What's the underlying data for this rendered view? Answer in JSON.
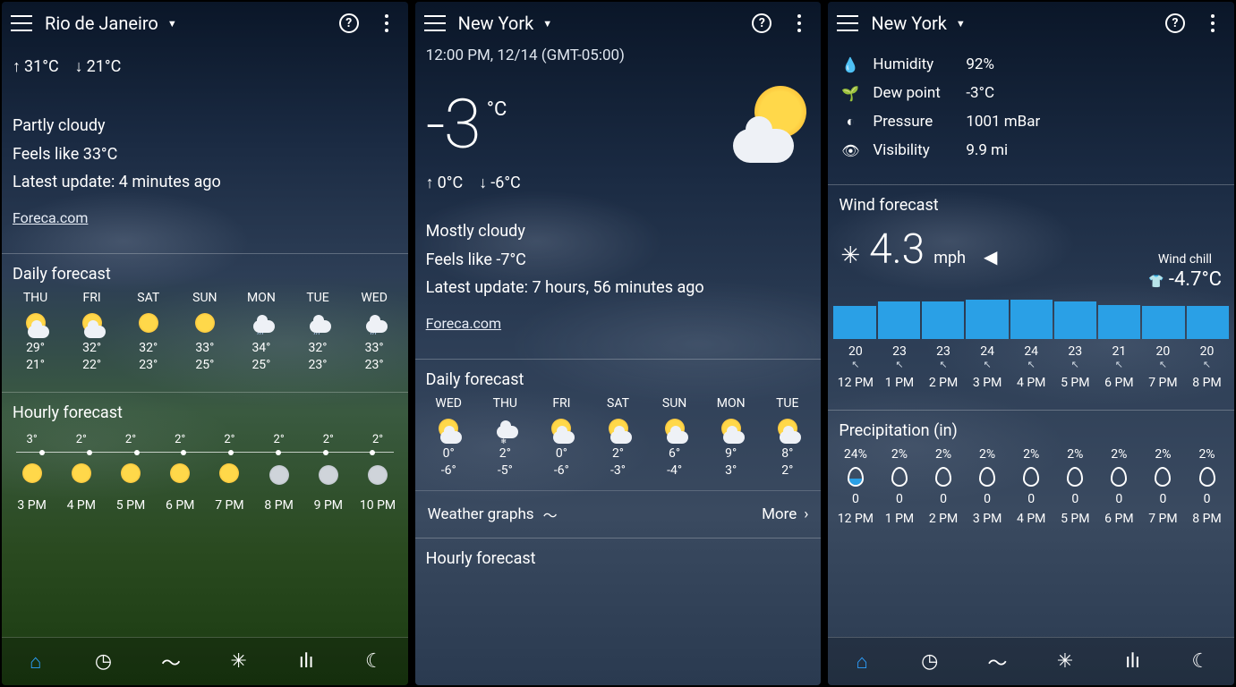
{
  "screens": [
    {
      "city": "Rio de Janeiro",
      "high": "31°C",
      "low": "21°C",
      "condition": "Partly cloudy",
      "feels_like": "Feels like 33°C",
      "update": "Latest update: 4 minutes ago",
      "source_link": "Foreca.com",
      "daily_title": "Daily forecast",
      "daily": [
        {
          "dow": "THU",
          "icon": "partly",
          "hi": "29°",
          "lo": "21°"
        },
        {
          "dow": "FRI",
          "icon": "partly",
          "hi": "32°",
          "lo": "22°"
        },
        {
          "dow": "SAT",
          "icon": "sunny",
          "hi": "32°",
          "lo": "23°"
        },
        {
          "dow": "SUN",
          "icon": "sunny",
          "hi": "33°",
          "lo": "25°"
        },
        {
          "dow": "MON",
          "icon": "rain",
          "hi": "34°",
          "lo": "25°"
        },
        {
          "dow": "TUE",
          "icon": "rain",
          "hi": "32°",
          "lo": "23°"
        },
        {
          "dow": "WED",
          "icon": "rain",
          "hi": "33°",
          "lo": "23°"
        }
      ],
      "hourly_title": "Hourly forecast",
      "hourly_temps": [
        "3°",
        "2°",
        "2°",
        "2°",
        "2°",
        "2°",
        "2°",
        "2°"
      ],
      "hourly": [
        {
          "time": "3 PM",
          "icon": "sunny"
        },
        {
          "time": "4 PM",
          "icon": "sunny"
        },
        {
          "time": "5 PM",
          "icon": "sunny"
        },
        {
          "time": "6 PM",
          "icon": "sunny"
        },
        {
          "time": "7 PM",
          "icon": "sunny"
        },
        {
          "time": "8 PM",
          "icon": "moon"
        },
        {
          "time": "9 PM",
          "icon": "moon"
        },
        {
          "time": "10 PM",
          "icon": "moon"
        }
      ]
    },
    {
      "city": "New York",
      "timestamp": "12:00 PM, 12/14 (GMT-05:00)",
      "temp": "-3",
      "unit": "°C",
      "high": "0°C",
      "low": "-6°C",
      "condition": "Mostly cloudy",
      "feels_like": "Feels like -7°C",
      "update": "Latest update: 7 hours, 56 minutes ago",
      "source_link": "Foreca.com",
      "daily_title": "Daily forecast",
      "daily": [
        {
          "dow": "WED",
          "icon": "partly",
          "hi": "0°",
          "lo": "-6°"
        },
        {
          "dow": "THU",
          "icon": "snow",
          "hi": "2°",
          "lo": "-5°"
        },
        {
          "dow": "FRI",
          "icon": "partly",
          "hi": "0°",
          "lo": "-6°"
        },
        {
          "dow": "SAT",
          "icon": "partly",
          "hi": "2°",
          "lo": "-3°"
        },
        {
          "dow": "SUN",
          "icon": "partly",
          "hi": "6°",
          "lo": "-4°"
        },
        {
          "dow": "MON",
          "icon": "partly",
          "hi": "9°",
          "lo": "3°"
        },
        {
          "dow": "TUE",
          "icon": "partly",
          "hi": "8°",
          "lo": "2°"
        }
      ],
      "graphs_label": "Weather graphs",
      "more_label": "More",
      "hourly_title": "Hourly forecast"
    },
    {
      "city": "New York",
      "details": [
        {
          "icon": "humidity",
          "label": "Humidity",
          "value": "92%"
        },
        {
          "icon": "dew",
          "label": "Dew point",
          "value": "-3°C"
        },
        {
          "icon": "pressure",
          "label": "Pressure",
          "value": "1001 mBar"
        },
        {
          "icon": "visibility",
          "label": "Visibility",
          "value": "9.9 mi"
        }
      ],
      "wind_title": "Wind forecast",
      "wind_speed": "4.3",
      "wind_unit": "mph",
      "wind_chill_label": "Wind chill",
      "wind_chill": "-4.7°C",
      "precip_title": "Precipitation (in)"
    }
  ],
  "nav": {
    "items": [
      "home",
      "clock",
      "graph",
      "wind",
      "bars",
      "moon"
    ]
  },
  "chart_data": [
    {
      "type": "bar",
      "title": "Wind forecast",
      "ylabel": "mph",
      "categories": [
        "12 PM",
        "1 PM",
        "2 PM",
        "3 PM",
        "4 PM",
        "5 PM",
        "6 PM",
        "7 PM",
        "8 PM"
      ],
      "values": [
        20,
        23,
        23,
        24,
        24,
        23,
        21,
        20,
        20
      ]
    },
    {
      "type": "bar",
      "title": "Precipitation (in)",
      "categories": [
        "12 PM",
        "1 PM",
        "2 PM",
        "3 PM",
        "4 PM",
        "5 PM",
        "6 PM",
        "7 PM",
        "8 PM"
      ],
      "probability_pct": [
        24,
        2,
        2,
        2,
        2,
        2,
        2,
        2,
        2
      ],
      "amount_in": [
        0,
        0,
        0,
        0,
        0,
        0,
        0,
        0,
        0
      ]
    }
  ]
}
